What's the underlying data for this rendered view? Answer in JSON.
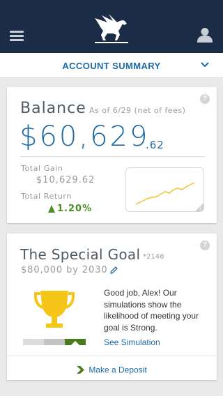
{
  "header": {
    "menu_icon": "hamburger-icon",
    "logo_icon": "pegasus-logo",
    "profile_icon": "user-icon"
  },
  "subnav": {
    "title": "ACCOUNT SUMMARY",
    "dropdown_icon": "chevron-down-icon"
  },
  "balance_card": {
    "title": "Balance",
    "as_of": "As of 6/29 (net of fees)",
    "amount_whole": "$60,629",
    "amount_cents": ".62",
    "total_gain_label": "Total Gain",
    "total_gain_value": "$10,629.62",
    "total_return_label": "Total Return",
    "total_return_value": "1.20%",
    "help_label": "?",
    "colors": {
      "accent": "#1f6aa5",
      "positive": "#4a8c25",
      "sparkline": "#f2c12e"
    }
  },
  "goal_card": {
    "title": "The Special Goal",
    "account_suffix": "*2146",
    "target": "$80,000 by 2030",
    "help_label": "?",
    "message": "Good job, Alex! Our simulations show the likelihood of meeting your goal is Strong.",
    "see_simulation": "See Simulation",
    "make_deposit": "Make a Deposit",
    "likelihood_level": "Strong",
    "colors": {
      "trophy": "#f5c518",
      "strong": "#4a7a1e",
      "meter_bg": "#d9d9d9"
    }
  }
}
